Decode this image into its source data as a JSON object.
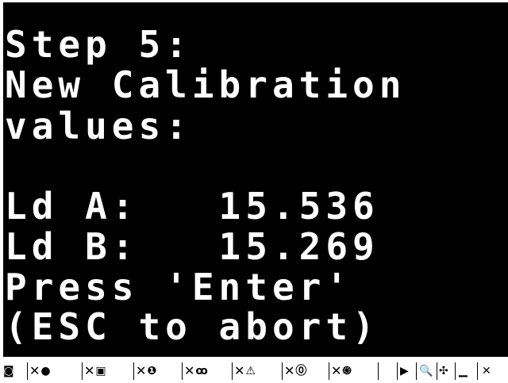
{
  "screen": {
    "lines": [
      "Step 5:",
      "New Calibration",
      "values:",
      "Ld A:   15.536",
      "Ld B:   15.269",
      "Press 'Enter'",
      "(ESC to abort)"
    ]
  },
  "toolbar": {
    "x_glyph": "✕",
    "items": [
      {
        "icon": "camera-icon",
        "glyph": "◙"
      },
      {
        "icon": "filled-circle-icon",
        "glyph": "●"
      },
      {
        "icon": "square-box-icon",
        "glyph": "▣"
      },
      {
        "icon": "info-circle-icon",
        "glyph": "❶"
      },
      {
        "icon": "binoculars-icon",
        "glyph": "ꝏ"
      },
      {
        "icon": "warning-triangle-icon",
        "glyph": "⚠"
      },
      {
        "icon": "circled-i-icon",
        "glyph": "⓪"
      },
      {
        "icon": "starburst-icon",
        "glyph": "֍"
      }
    ],
    "right": [
      {
        "icon": "play-icon",
        "glyph": "▶"
      },
      {
        "icon": "zoom-icon",
        "glyph": "🔍"
      },
      {
        "icon": "move-icon",
        "glyph": "✣"
      },
      {
        "icon": "minimize-icon",
        "glyph": "▁"
      },
      {
        "icon": "close-icon",
        "glyph": "✕"
      }
    ]
  }
}
